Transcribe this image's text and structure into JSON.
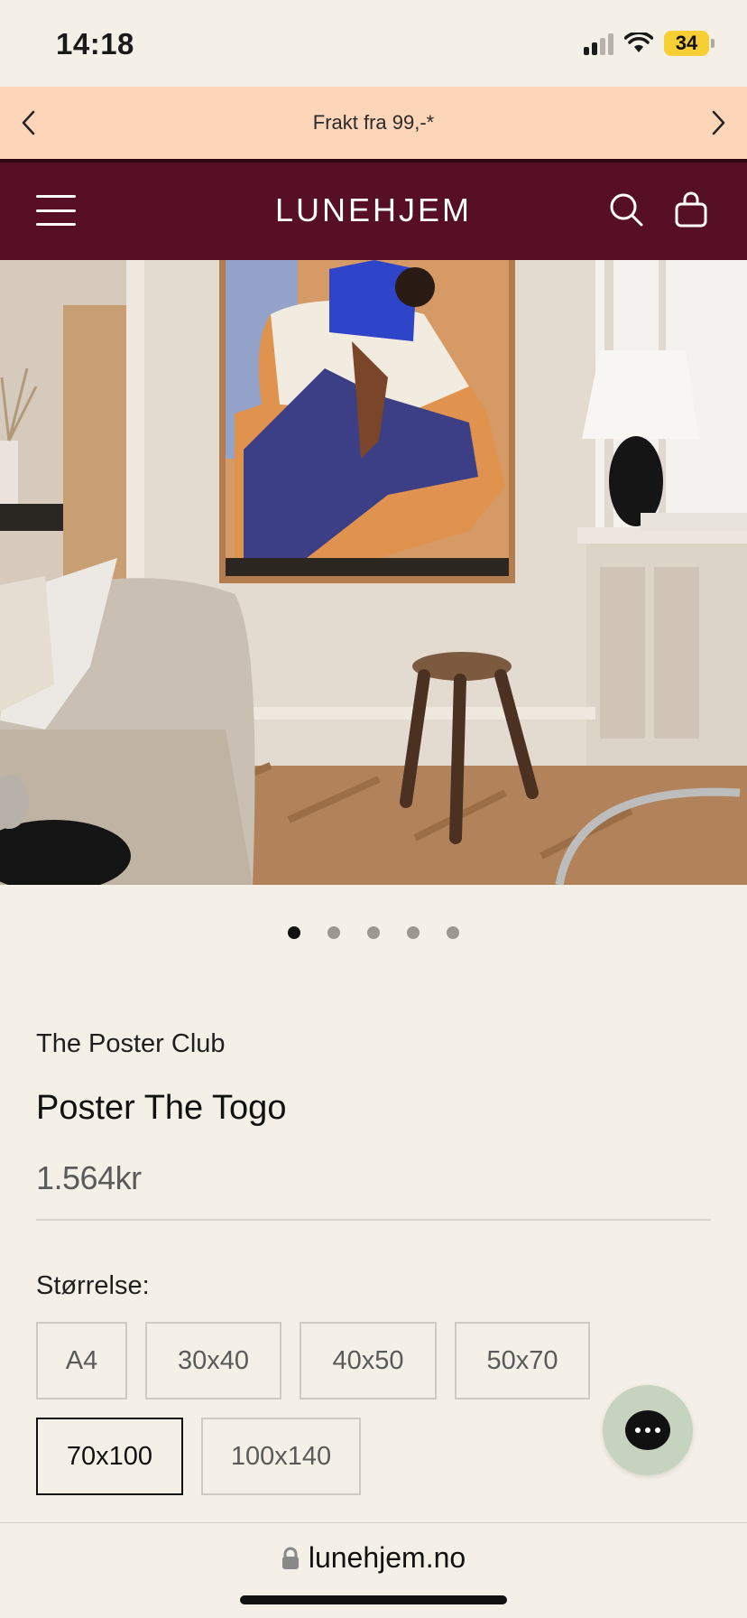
{
  "status": {
    "time": "14:18",
    "battery": "34"
  },
  "promo": {
    "text": "Frakt fra 99,-*",
    "prev_icon": "chevron-left-icon",
    "next_icon": "chevron-right-icon"
  },
  "header": {
    "logo": "LUNEHJEM",
    "menu_icon": "hamburger-menu-icon",
    "search_icon": "search-icon",
    "cart_icon": "shopping-bag-icon",
    "background": "#560f24"
  },
  "gallery": {
    "slide_count": 5,
    "active_index": 0
  },
  "product": {
    "vendor": "The Poster Club",
    "title": "Poster The Togo",
    "price": "1.564kr"
  },
  "size": {
    "label": "Størrelse:",
    "options": [
      "A4",
      "30x40",
      "40x50",
      "50x70",
      "70x100",
      "100x140"
    ],
    "selected": "70x100"
  },
  "chat": {
    "icon": "chat-bubble-icon",
    "color": "#c6d4bf"
  },
  "browser": {
    "url": "lunehjem.no",
    "lock_icon": "lock-icon"
  }
}
